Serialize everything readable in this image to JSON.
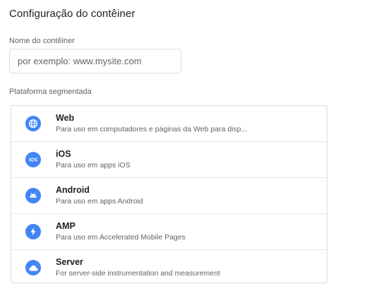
{
  "page": {
    "title": "Configuração do contêiner"
  },
  "container_name": {
    "label": "Nome do contêiner",
    "value": "",
    "placeholder": "por exemplo: www.mysite.com"
  },
  "platform": {
    "label": "Plataforma segmentada",
    "accent_color": "#4285f4",
    "items": [
      {
        "name": "Web",
        "description": "Para uso em computadores e páginas da Web para disp...",
        "icon": "globe-icon"
      },
      {
        "name": "iOS",
        "description": "Para uso em apps iOS",
        "icon": "ios-icon"
      },
      {
        "name": "Android",
        "description": "Para uso em apps Android",
        "icon": "android-icon"
      },
      {
        "name": "AMP",
        "description": "Para uso em Accelerated Mobile Pages",
        "icon": "amp-lightning-icon"
      },
      {
        "name": "Server",
        "description": "For server-side instrumentation and measurement",
        "icon": "cloud-icon"
      }
    ]
  }
}
